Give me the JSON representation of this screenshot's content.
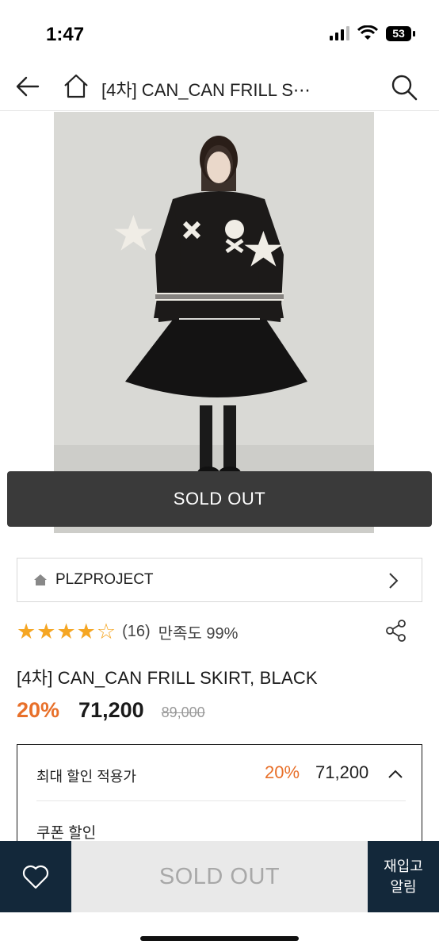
{
  "status_bar": {
    "time": "1:47",
    "battery": "53"
  },
  "nav": {
    "title": "[4차] CAN_CAN FRILL S⋯"
  },
  "product": {
    "sold_out_banner": "SOLD OUT",
    "brand": "PLZPROJECT",
    "rating": {
      "stars": 4,
      "max_stars": 5,
      "review_count": "(16)",
      "satisfaction": "만족도 99%"
    },
    "title": "[4차] CAN_CAN FRILL SKIRT, BLACK",
    "discount_rate": "20%",
    "sale_price": "71,200",
    "original_price": "89,000"
  },
  "discount_box": {
    "max_label": "최대 할인 적용가",
    "max_rate": "20%",
    "max_price": "71,200",
    "coupon_label": "쿠폰 할인"
  },
  "bottom_bar": {
    "soldout_label": "SOLD OUT",
    "restock_line1": "재입고",
    "restock_line2": "알림"
  },
  "colors": {
    "accent": "#e8702a",
    "navy": "#13283a",
    "star": "#f5a623"
  },
  "icons": [
    "back-arrow-icon",
    "home-icon",
    "search-icon",
    "chevron-right-icon",
    "share-icon",
    "chevron-up-icon",
    "heart-icon",
    "signal-icon",
    "wifi-icon",
    "battery-icon"
  ]
}
